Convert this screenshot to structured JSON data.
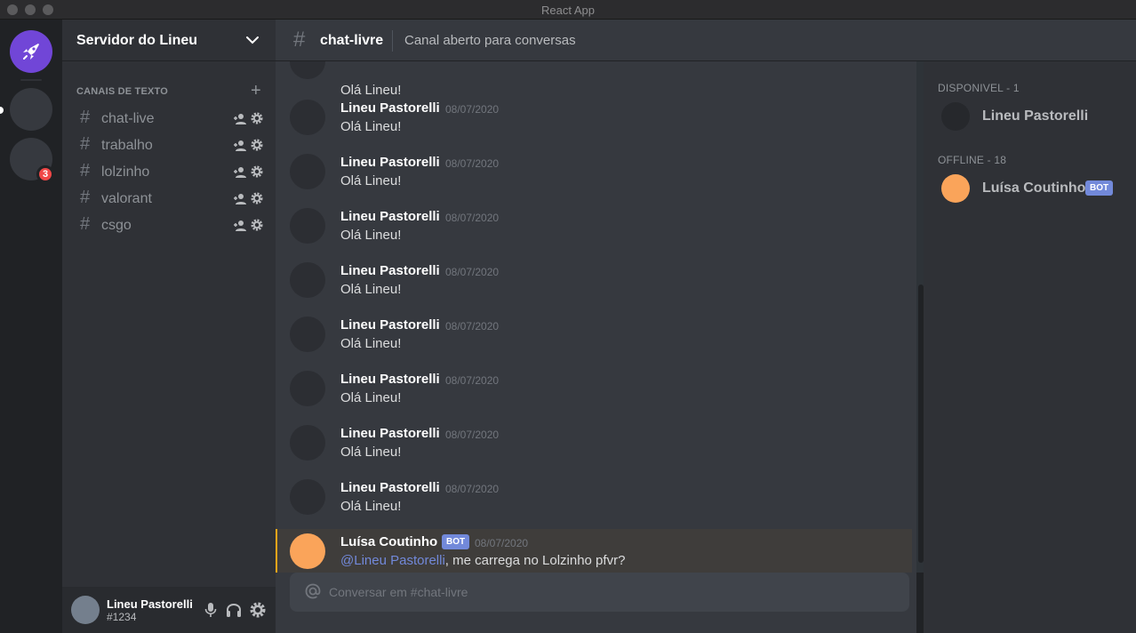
{
  "window": {
    "title": "React App"
  },
  "servers": {
    "main_label": "Rocketseat",
    "badge_count": "3"
  },
  "sidebar": {
    "guild_name": "Servidor do Lineu",
    "category": "CANAIS DE TEXTO",
    "channels": [
      {
        "name": "chat-live"
      },
      {
        "name": "trabalho"
      },
      {
        "name": "lolzinho"
      },
      {
        "name": "valorant"
      },
      {
        "name": "csgo"
      }
    ]
  },
  "user": {
    "name": "Lineu Pastorelli",
    "tag": "#1234"
  },
  "chat_header": {
    "hash": "#",
    "channel": "chat-livre",
    "topic": "Canal aberto para conversas"
  },
  "messages": {
    "partial_text": "Olá Lineu!",
    "items": [
      {
        "author": "Lineu Pastorelli",
        "date": "08/07/2020",
        "text": "Olá Lineu!"
      },
      {
        "author": "Lineu Pastorelli",
        "date": "08/07/2020",
        "text": "Olá Lineu!"
      },
      {
        "author": "Lineu Pastorelli",
        "date": "08/07/2020",
        "text": "Olá Lineu!"
      },
      {
        "author": "Lineu Pastorelli",
        "date": "08/07/2020",
        "text": "Olá Lineu!"
      },
      {
        "author": "Lineu Pastorelli",
        "date": "08/07/2020",
        "text": "Olá Lineu!"
      },
      {
        "author": "Lineu Pastorelli",
        "date": "08/07/2020",
        "text": "Olá Lineu!"
      },
      {
        "author": "Lineu Pastorelli",
        "date": "08/07/2020",
        "text": "Olá Lineu!"
      },
      {
        "author": "Lineu Pastorelli",
        "date": "08/07/2020",
        "text": "Olá Lineu!"
      }
    ],
    "bot_message": {
      "author": "Luísa Coutinho",
      "tag": "BOT",
      "date": "08/07/2020",
      "mention": "@Lineu Pastorelli",
      "text": ", me carrega no Lolzinho pfvr?"
    }
  },
  "composer": {
    "placeholder": "Conversar em #chat-livre"
  },
  "members": {
    "online_label": "DISPONIVEL - 1",
    "offline_label": "OFFLINE - 18",
    "online": [
      {
        "name": "Lineu Pastorelli"
      }
    ],
    "offline": [
      {
        "name": "Luísa Coutinho",
        "tag": "BOT"
      }
    ]
  },
  "colors": {
    "brand": "#7146d7",
    "accent_blurple": "#7289da",
    "mention_bar": "#faa61a",
    "bot_avatar": "#faa45a",
    "badge_red": "#f04747"
  }
}
